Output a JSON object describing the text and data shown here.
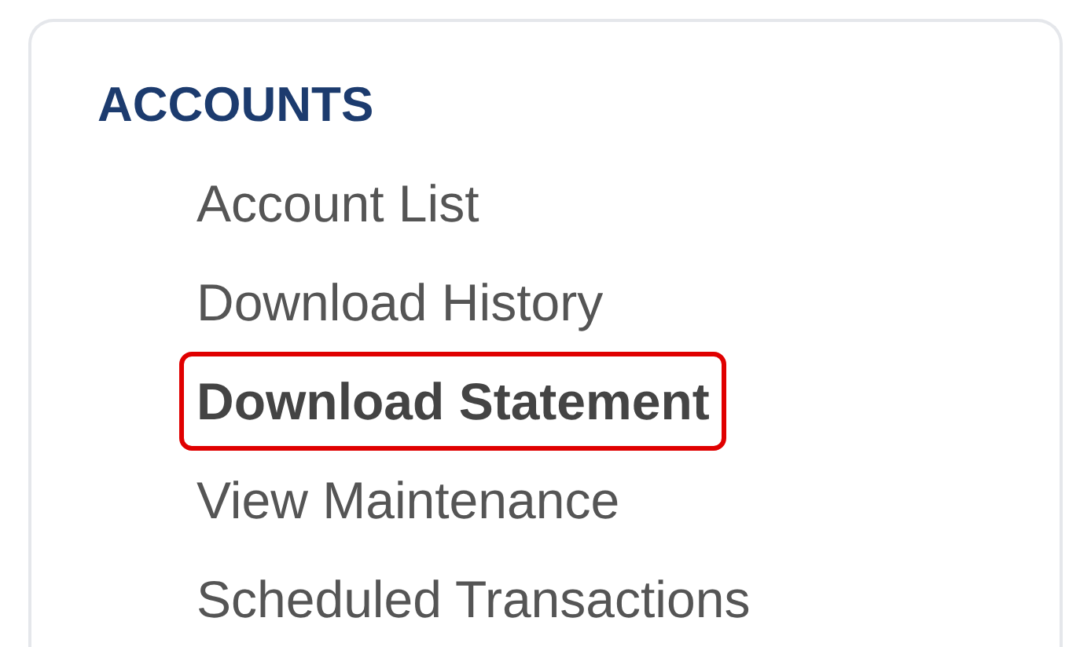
{
  "section": {
    "title": "ACCOUNTS"
  },
  "items": [
    {
      "label": "Account List",
      "selected": false
    },
    {
      "label": "Download History",
      "selected": false
    },
    {
      "label": "Download Statement",
      "selected": true
    },
    {
      "label": "View Maintenance",
      "selected": false
    },
    {
      "label": "Scheduled Transactions",
      "selected": false
    }
  ]
}
